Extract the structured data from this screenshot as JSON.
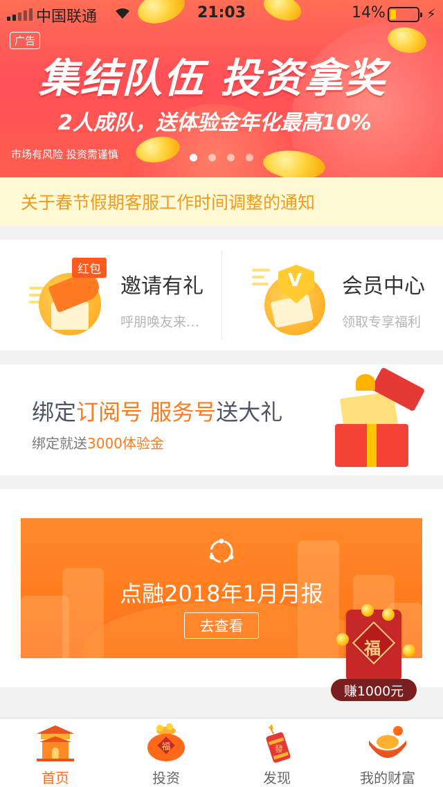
{
  "status_bar": {
    "carrier": "中国联通",
    "time": "21:03",
    "battery_percent": "14%",
    "battery_level": 0.14
  },
  "banner": {
    "ad_tag": "广告",
    "title": "集结队伍 投资拿奖",
    "subtitle": "2人成队，送体验金年化最高10%",
    "risk_notice": "市场有风险 投资需谨慎",
    "slide_count": 4,
    "active_slide": 0
  },
  "notice": {
    "text": "关于春节假期客服工作时间调整的通知"
  },
  "features": [
    {
      "title": "邀请有礼",
      "desc": "呼朋唤友来…",
      "tag": "红包",
      "icon": "megaphone-gift-icon"
    },
    {
      "title": "会员中心",
      "desc": "领取专享福利",
      "icon": "vip-shield-icon"
    }
  ],
  "bind_card": {
    "prefix": "绑定",
    "highlight1": "订阅号",
    "highlight2": "服务号",
    "suffix": "送大礼",
    "sub_prefix": "绑定就送",
    "sub_highlight": "3000体验金",
    "icon": "gift-box-icon"
  },
  "report_card": {
    "title": "点融2018年1月月报",
    "button": "去查看",
    "icon": "dianrong-logo-icon"
  },
  "floating_packet": {
    "label": "赚1000元",
    "glyph": "福",
    "icon": "red-packet-icon"
  },
  "tabbar": {
    "active": 0,
    "tabs": [
      {
        "label": "首页",
        "icon": "palace-icon"
      },
      {
        "label": "投资",
        "icon": "money-bag-icon"
      },
      {
        "label": "发现",
        "icon": "firecracker-icon"
      },
      {
        "label": "我的财富",
        "icon": "gold-ingot-icon"
      }
    ]
  },
  "colors": {
    "accent": "#ff7a1c",
    "banner_red": "#ff5257",
    "notice_text": "#f29a1c",
    "notice_bg": "#fff9d6",
    "report_orange": "#ff7b1e",
    "packet_red": "#c62828"
  }
}
